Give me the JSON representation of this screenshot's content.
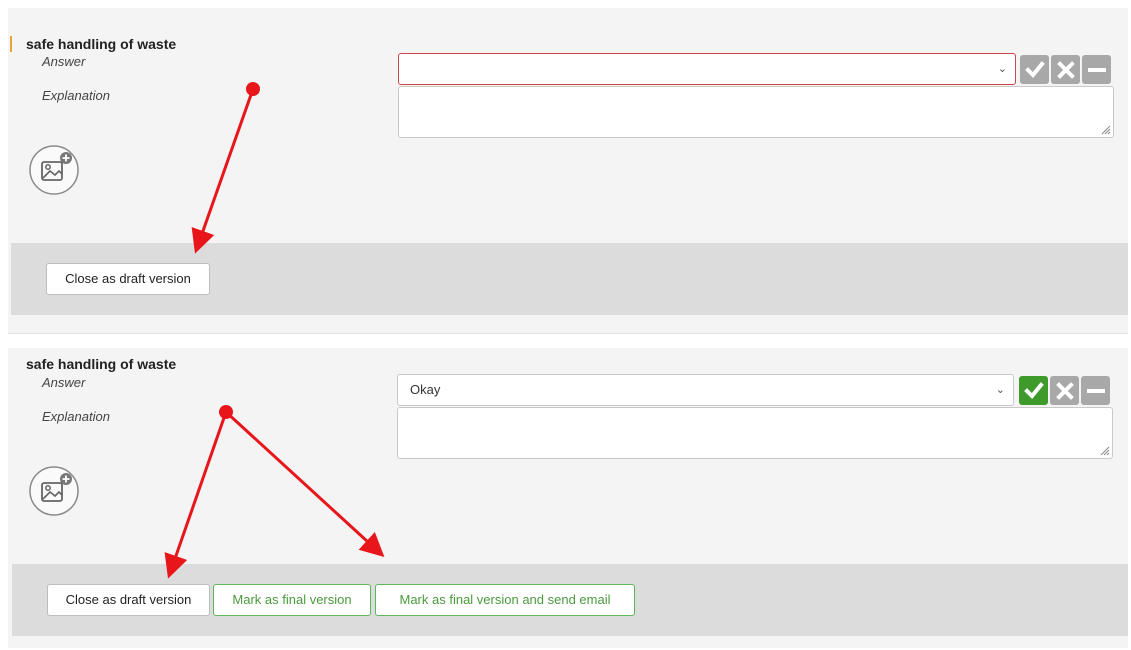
{
  "panels": [
    {
      "question": "safe handling of waste",
      "answer_label": "Answer",
      "explanation_label": "Explanation",
      "answer_value": "",
      "buttons": {
        "close_draft": "Close as draft version"
      }
    },
    {
      "question": "safe handling of waste",
      "answer_label": "Answer",
      "explanation_label": "Explanation",
      "answer_value": "Okay",
      "buttons": {
        "close_draft": "Close as draft version",
        "mark_final": "Mark as final version",
        "mark_final_email": "Mark as final version and send email"
      }
    }
  ],
  "icons": {
    "accept": "checkmark-icon",
    "reject": "x-icon",
    "neutral": "minus-icon",
    "add_image": "add-image-icon",
    "dropdown": "chevron-down-icon"
  },
  "colors": {
    "panel_bg": "#f4f4f4",
    "footer_bg": "#dcdcdc",
    "accent_bar": "#e8a33c",
    "error_border": "#c8474a",
    "accept_active": "#3f9a2c",
    "button_disabled": "#a8a8a8",
    "final_button": "#5cb85c",
    "annotation_arrow": "#e8161a"
  }
}
